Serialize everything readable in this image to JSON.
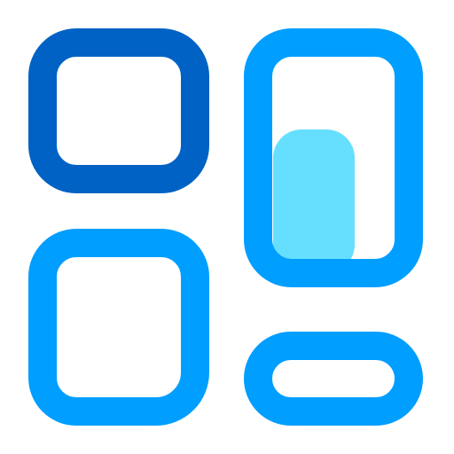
{
  "icon": {
    "name": "dashboard-layout-icon",
    "colors": {
      "primary_dark": "#0062C4",
      "primary": "#009EFF",
      "accent_light": "#66DFFF"
    },
    "tiles": [
      {
        "name": "top-left-tile",
        "color": "primary_dark"
      },
      {
        "name": "top-right-tile",
        "color": "primary"
      },
      {
        "name": "bottom-left-tile",
        "color": "primary"
      },
      {
        "name": "bottom-right-tile",
        "color": "primary"
      },
      {
        "name": "highlight-block",
        "color": "accent_light"
      }
    ]
  }
}
